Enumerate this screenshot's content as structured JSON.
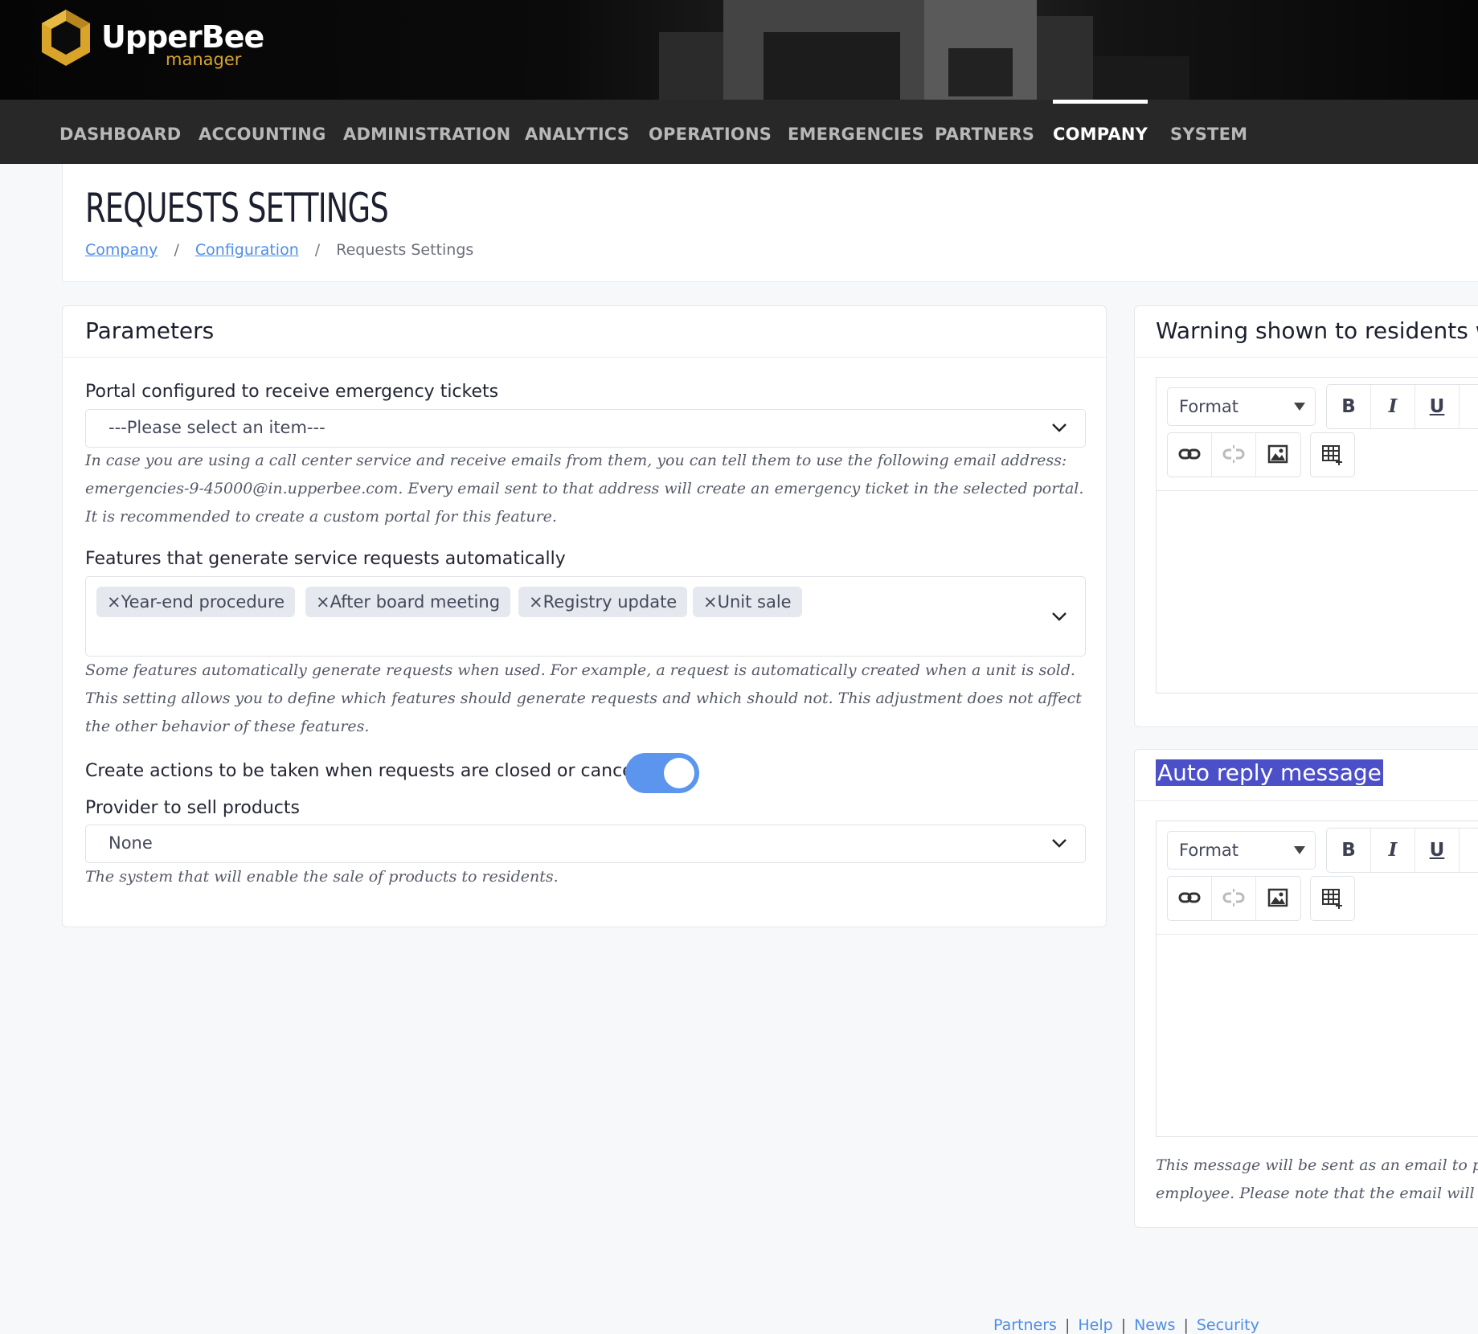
{
  "brand": {
    "name": "UpperBee",
    "sub": "manager",
    "accent": "#d9a429"
  },
  "nav": {
    "items": [
      {
        "label": "DASHBOARD"
      },
      {
        "label": "ACCOUNTING"
      },
      {
        "label": "ADMINISTRATION"
      },
      {
        "label": "ANALYTICS"
      },
      {
        "label": "OPERATIONS"
      },
      {
        "label": "EMERGENCIES"
      },
      {
        "label": "PARTNERS"
      },
      {
        "label": "COMPANY"
      },
      {
        "label": "SYSTEM"
      }
    ],
    "active": "COMPANY"
  },
  "page": {
    "title": "REQUESTS SETTINGS",
    "breadcrumb": [
      "Company",
      "Configuration",
      "Requests Settings"
    ]
  },
  "params": {
    "title": "Parameters",
    "portal_label": "Portal configured to receive emergency tickets",
    "portal_value": "---Please select an item---",
    "portal_help": "In case you are using a call center service and receive emails from them, you can tell them to use the following email address: emergencies-9-45000@in.upperbee.com. Every email sent to that address will create an emergency ticket in the selected portal. It is recommended to create a custom portal for this feature.",
    "features_label": "Features that generate service requests automatically",
    "features_chips": [
      "×Year-end procedure",
      "×After board meeting",
      "×Registry update",
      "×Unit sale"
    ],
    "features_help": "Some features automatically generate requests when used. For example, a request is automatically created when a unit is sold. This setting allows you to define which features should generate requests and which should not. This adjustment does not affect the other behavior of these features.",
    "actions_label": "Create actions to be taken when requests are closed or cancelled",
    "actions_enabled": true,
    "provider_label": "Provider to sell products",
    "provider_value": "None",
    "provider_help": "The system that will enable the sale of products to residents."
  },
  "warning_editor": {
    "title": "Warning shown to residents w",
    "format_label": "Format",
    "bold": "B",
    "italic": "I",
    "underline": "U"
  },
  "auto_reply_editor": {
    "title": "Auto reply message",
    "format_label": "Format",
    "bold": "B",
    "italic": "I",
    "underline": "U",
    "help_line1": "This message will be sent as an email to peop",
    "help_line2": "employee. Please note that the email will also"
  },
  "footer": {
    "links": [
      "Partners",
      "Help",
      "News",
      "Security"
    ]
  },
  "colors": {
    "toggle_on": "#5b95ee",
    "link": "#4d8ee8",
    "nav_bg": "#282828"
  }
}
